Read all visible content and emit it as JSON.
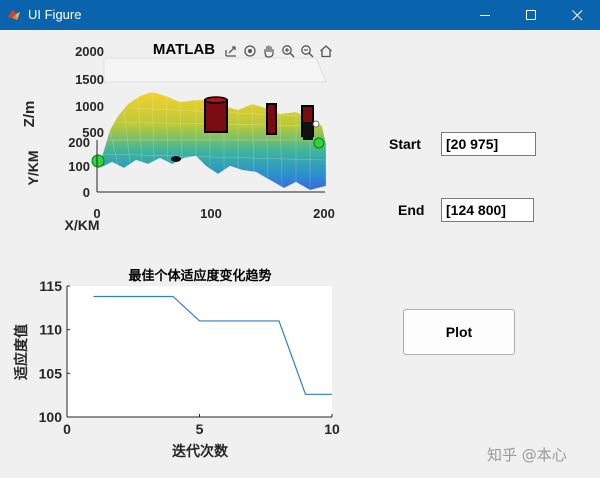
{
  "window": {
    "title": "UI Figure",
    "icon": "matlab-logo-icon"
  },
  "axes3d": {
    "title": "MATLAB",
    "zlabel": "Z/m",
    "ylabel": "Y/KM",
    "xlabel": "X/KM",
    "z_ticks": [
      "2000",
      "1500",
      "1000",
      "500"
    ],
    "y_ticks": [
      "200",
      "100",
      "0"
    ],
    "x_ticks": [
      "0",
      "100",
      "200"
    ],
    "toolbar": [
      "export-icon",
      "rotate-icon",
      "pan-icon",
      "zoom-in-icon",
      "zoom-out-icon",
      "home-icon"
    ]
  },
  "controls": {
    "start_label": "Start",
    "start_value": "[20 975]",
    "end_label": "End",
    "end_value": "[124 800]",
    "plot_label": "Plot"
  },
  "chart_data": {
    "type": "line",
    "title": "最佳个体适应度变化趋势",
    "xlabel": "迭代次数",
    "ylabel": "适应度值",
    "xlim": [
      0,
      10
    ],
    "ylim": [
      100,
      115
    ],
    "x_ticks": [
      "0",
      "5",
      "10"
    ],
    "y_ticks": [
      "115",
      "110",
      "105",
      "100"
    ],
    "x": [
      1,
      2,
      3,
      4,
      5,
      6,
      7,
      8,
      9,
      10
    ],
    "values": [
      113.8,
      113.8,
      113.8,
      113.8,
      111.0,
      111.0,
      111.0,
      111.0,
      102.6,
      102.6
    ],
    "color": "#2f7fc1"
  },
  "watermark": "知乎 @本心"
}
